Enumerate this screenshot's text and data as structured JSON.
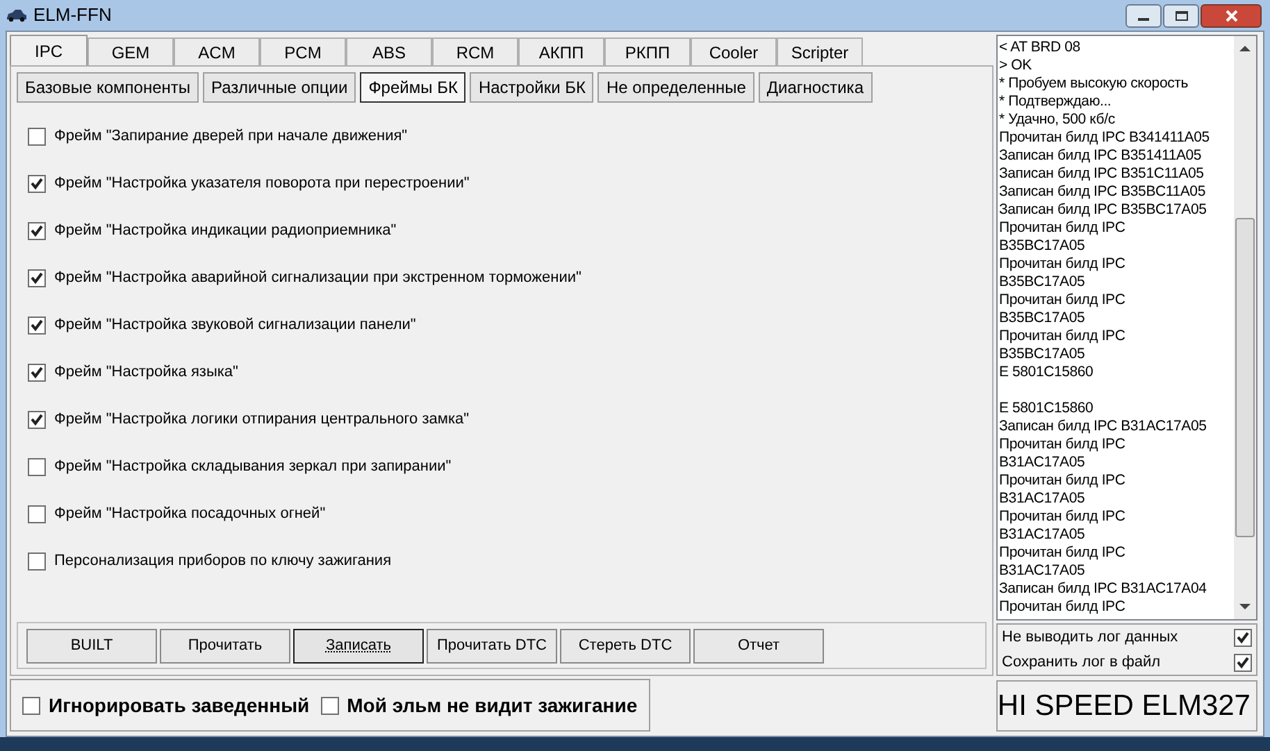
{
  "window": {
    "title": "ELM-FFN"
  },
  "tabs": [
    {
      "label": "IPC",
      "selected": true
    },
    {
      "label": "GEM",
      "selected": false
    },
    {
      "label": "ACM",
      "selected": false
    },
    {
      "label": "PCM",
      "selected": false
    },
    {
      "label": "ABS",
      "selected": false
    },
    {
      "label": "RCM",
      "selected": false
    },
    {
      "label": "АКПП",
      "selected": false
    },
    {
      "label": "РКПП",
      "selected": false
    },
    {
      "label": "Cooler",
      "selected": false
    },
    {
      "label": "Scripter",
      "selected": false
    }
  ],
  "subtabs": [
    {
      "label": "Базовые компоненты",
      "selected": false
    },
    {
      "label": "Различные опции",
      "selected": false
    },
    {
      "label": "Фреймы БК",
      "selected": true
    },
    {
      "label": "Настройки БК",
      "selected": false
    },
    {
      "label": "Не определенные",
      "selected": false
    },
    {
      "label": "Диагностика",
      "selected": false
    }
  ],
  "options": [
    {
      "label": "Фрейм \"Запирание дверей при начале движения\"",
      "checked": false
    },
    {
      "label": "Фрейм \"Настройка указателя поворота при перестроении\"",
      "checked": true
    },
    {
      "label": "Фрейм \"Настройка индикации радиоприемника\"",
      "checked": true
    },
    {
      "label": "Фрейм \"Настройка аварийной сигнализации при экстренном торможении\"",
      "checked": true
    },
    {
      "label": "Фрейм \"Настройка звуковой сигнализации панели\"",
      "checked": true
    },
    {
      "label": "Фрейм \"Настройка языка\"",
      "checked": true
    },
    {
      "label": "Фрейм \"Настройка логики отпирания центрального замка\"",
      "checked": true
    },
    {
      "label": "Фрейм \"Настройка складывания зеркал при запирании\"",
      "checked": false
    },
    {
      "label": "Фрейм \"Настройка посадочных огней\"",
      "checked": false
    },
    {
      "label": "Персонализация приборов по ключу зажигания",
      "checked": false
    }
  ],
  "buttons": [
    {
      "label": "BUILT",
      "focused": false
    },
    {
      "label": "Прочитать",
      "focused": false
    },
    {
      "label": "Записать",
      "focused": true
    },
    {
      "label": "Прочитать DTC",
      "focused": false
    },
    {
      "label": "Стереть DTC",
      "focused": false
    },
    {
      "label": "Отчет",
      "focused": false
    }
  ],
  "bottom_options": [
    {
      "label": "Игнорировать заведенный",
      "checked": false
    },
    {
      "label": "Мой эльм не видит зажигание",
      "checked": false
    }
  ],
  "log": [
    "< AT BRD 08",
    "> OK",
    "* Пробуем высокую скорость",
    "* Подтверждаю...",
    "* Удачно, 500 кб/с",
    "Прочитан билд IPC B341411A05",
    "Записан билд IPC B351411A05",
    "Записан билд IPC B351C11A05",
    "Записан билд IPC B35BC11A05",
    "Записан билд IPC B35BC17A05",
    "Прочитан билд IPC",
    "B35BC17A05",
    "Прочитан билд IPC",
    "B35BC17A05",
    "Прочитан билд IPC",
    "B35BC17A05",
    "Прочитан билд IPC",
    "B35BC17A05",
    "E 5801C15860",
    "E 5801C15860",
    "Записан билд IPC B31AC17A05",
    "Прочитан билд IPC",
    "B31AC17A05",
    "Прочитан билд IPC",
    "B31AC17A05",
    "Прочитан билд IPC",
    "B31AC17A05",
    "Прочитан билд IPC",
    "B31AC17A05",
    "Записан билд IPC B31AC17A04",
    "Прочитан билд IPC"
  ],
  "log_options": [
    {
      "label": "Не выводить лог данных",
      "checked": true
    },
    {
      "label": "Сохранить лог в файл",
      "checked": true
    }
  ],
  "status": "HI SPEED ELM327"
}
